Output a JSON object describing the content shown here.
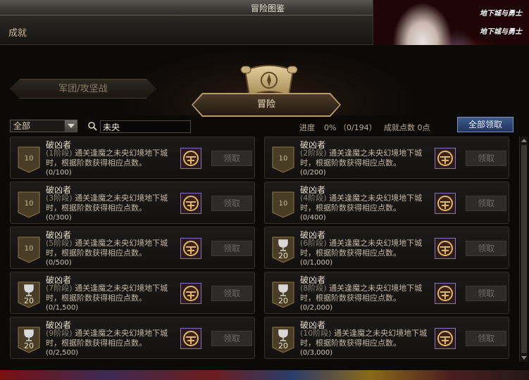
{
  "window": {
    "title": "冒险图鉴"
  },
  "banner": {
    "logo_a": "地下城与勇士",
    "logo_b": "地下城与勇士"
  },
  "section": {
    "title": "成就"
  },
  "tabs": {
    "legion": "军团/攻坚战",
    "adventure": "冒险"
  },
  "filter": {
    "select_value": "全部",
    "search_value": "未央",
    "progress_label": "进度",
    "progress_value": "0% （0/194）",
    "points_label": "成就点数 0点",
    "claim_all_label": "全部领取"
  },
  "achievements": [
    {
      "title": "破凶者",
      "stage": "(1阶段)",
      "desc": " 通关逢魔之未央幻境地下城时，根据阶数获得相应点数。",
      "progress": "(0/100)",
      "badge_type": "rank",
      "badge_value": "10",
      "claim_label": "领取"
    },
    {
      "title": "破凶者",
      "stage": "(2阶段)",
      "desc": " 通关逢魔之未央幻境地下城时，根据阶数获得相应点数。",
      "progress": "(0/200)",
      "badge_type": "rank",
      "badge_value": "10",
      "claim_label": "领取"
    },
    {
      "title": "破凶者",
      "stage": "(3阶段)",
      "desc": " 通关逢魔之未央幻境地下城时，根据阶数获得相应点数。",
      "progress": "(0/300)",
      "badge_type": "rank",
      "badge_value": "10",
      "claim_label": "领取"
    },
    {
      "title": "破凶者",
      "stage": "(4阶段)",
      "desc": " 通关逢魔之未央幻境地下城时，根据阶数获得相应点数。",
      "progress": "(0/400)",
      "badge_type": "rank",
      "badge_value": "10",
      "claim_label": "领取"
    },
    {
      "title": "破凶者",
      "stage": "(5阶段)",
      "desc": " 通关逢魔之未央幻境地下城时，根据阶数获得相应点数。",
      "progress": "(0/500)",
      "badge_type": "rank",
      "badge_value": "10",
      "claim_label": "领取"
    },
    {
      "title": "破凶者",
      "stage": "(6阶段)",
      "desc": " 通关逢魔之未央幻境地下城时，根据阶数获得相应点数。",
      "progress": "(0/1,000)",
      "badge_type": "trophy",
      "badge_value": "20",
      "claim_label": "领取"
    },
    {
      "title": "破凶者",
      "stage": "(7阶段)",
      "desc": " 通关逢魔之未央幻境地下城时，根据阶数获得相应点数。",
      "progress": "(0/1,500)",
      "badge_type": "trophy",
      "badge_value": "20",
      "claim_label": "领取"
    },
    {
      "title": "破凶者",
      "stage": "(8阶段)",
      "desc": " 通关逢魔之未央幻境地下城时，根据阶数获得相应点数。",
      "progress": "(0/2,000)",
      "badge_type": "trophy",
      "badge_value": "20",
      "claim_label": "领取"
    },
    {
      "title": "破凶者",
      "stage": "(9阶段)",
      "desc": " 通关逢魔之未央幻境地下城时，根据阶数获得相应点数。",
      "progress": "(0/2,500)",
      "badge_type": "trophy",
      "badge_value": "20",
      "claim_label": "领取"
    },
    {
      "title": "破凶者",
      "stage": "(10阶段)",
      "desc": " 通关逢魔之未央幻境地下城时，根据阶数获得相应点数。",
      "progress": "(0/3,000)",
      "badge_type": "trophy",
      "badge_value": "20",
      "claim_label": "领取"
    }
  ],
  "icons": {
    "search": "search-icon",
    "scroll_emblem": "scroll-compass-icon",
    "rank_badge": "rank-shield-icon",
    "trophy_badge": "trophy-icon",
    "reward": "reward-emblem-icon"
  },
  "colors": {
    "accent_gold": "#b59a6a",
    "claim_all_blue": "#2f4775",
    "reward_border": "#8d6fb3"
  }
}
